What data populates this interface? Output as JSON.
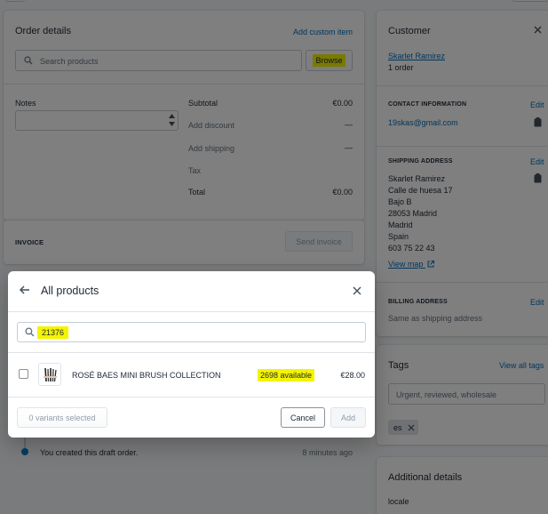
{
  "order": {
    "title": "Order details",
    "add_custom_item": "Add custom item",
    "search_placeholder": "Search products",
    "browse": "Browse",
    "notes_label": "Notes",
    "subtotal_label": "Subtotal",
    "subtotal_value": "€0.00",
    "discount_label": "Add discount",
    "discount_value": "—",
    "shipping_label": "Add shipping",
    "shipping_value": "—",
    "tax_label": "Tax",
    "total_label": "Total",
    "total_value": "€0.00"
  },
  "invoice": {
    "label": "INVOICE",
    "send": "Send invoice"
  },
  "timeline": {
    "event": "You created this draft order.",
    "time": "8 minutes ago"
  },
  "customer": {
    "title": "Customer",
    "name": "Skarlet Ramirez",
    "orders": "1 order",
    "contact_label": "CONTACT INFORMATION",
    "edit": "Edit",
    "email": "19skas@gmail.com",
    "shipping_label": "SHIPPING ADDRESS",
    "address_lines": [
      "Skarlet Ramirez",
      "Calle de huesa 17",
      "Bajo B",
      "28053 Madrid",
      "Madrid",
      "Spain",
      "603 75 22 43"
    ],
    "view_map": "View map",
    "billing_label": "BILLING ADDRESS",
    "billing_value": "Same as shipping address"
  },
  "tags": {
    "title": "Tags",
    "view_all": "View all tags",
    "placeholder": "Urgent, reviewed, wholesale",
    "chip": "es"
  },
  "additional": {
    "title": "Additional details",
    "locale_label": "locale"
  },
  "modal": {
    "title": "All products",
    "search_value": "21376",
    "product": {
      "name": "ROSÉ BAES MINI BRUSH COLLECTION",
      "availability": "2698 available",
      "price": "€28.00"
    },
    "variants_selected": "0 variants selected",
    "cancel": "Cancel",
    "add": "Add"
  }
}
